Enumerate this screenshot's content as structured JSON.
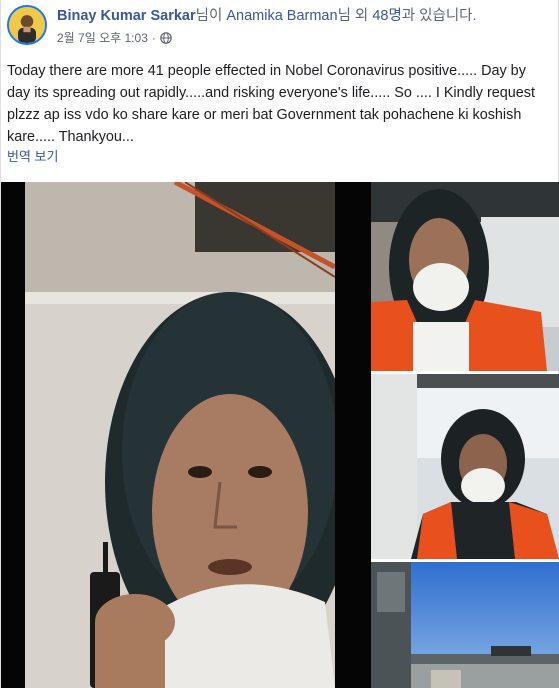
{
  "post": {
    "author": "Binay Kumar Sarkar",
    "with_text": "님이",
    "tagged_user": "Anamika Barman",
    "and_text": "님 외",
    "others_count": "48명",
    "with_suffix": "과 있습니다.",
    "date": "2월 7일 오후 1:03",
    "separator": "·",
    "privacy_icon": "globe-icon",
    "text": "Today there are more 41 people effected in Nobel Coronavirus positive..... Day by day its spreading out rapidly.....and risking everyone's life..... So .... I Kindly request plzzz ap iss vdo ko share kare or meri bat Government tak pohachene ki koshish kare..... Thankyou...",
    "see_translation": "번역 보기"
  },
  "photos": [
    {
      "name": "main-photo",
      "icon": "photo"
    },
    {
      "name": "photo-top-right",
      "icon": "photo"
    },
    {
      "name": "photo-middle-right",
      "icon": "photo"
    },
    {
      "name": "photo-bottom-right",
      "icon": "photo"
    }
  ],
  "colors": {
    "link": "#385898",
    "text": "#1c1e21",
    "muted": "#606770",
    "vest_orange": "#e8501e"
  }
}
